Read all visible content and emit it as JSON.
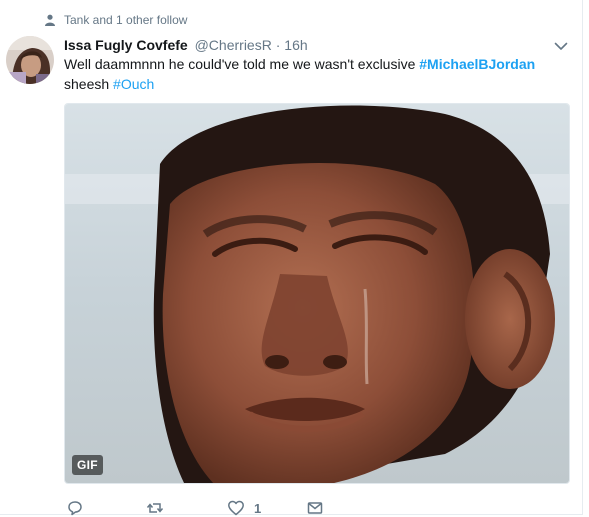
{
  "context": {
    "text": "Tank and 1 other follow",
    "icon": "person-icon"
  },
  "tweet": {
    "author": {
      "name": "Issa Fugly Covfefe",
      "handle": "@CherriesR",
      "separator": "·",
      "time": "16h",
      "avatar": "avatar-photo"
    },
    "text": {
      "part1": "Well daammnnn he could've told me we wasn't exclusive ",
      "hashtag1": "#MichaelBJordan",
      "part2": "sheesh ",
      "hashtag2": "#Ouch"
    },
    "media": {
      "type": "gif",
      "badge": "GIF",
      "description_icon": "crying-boy-gif"
    },
    "actions": {
      "reply_icon": "reply-icon",
      "retweet_icon": "retweet-icon",
      "like_icon": "heart-icon",
      "like_count": "1",
      "dm_icon": "envelope-icon"
    }
  },
  "colors": {
    "link": "#1da1f2",
    "muted": "#657786",
    "text": "#14171a",
    "border": "#e1e8ed"
  }
}
